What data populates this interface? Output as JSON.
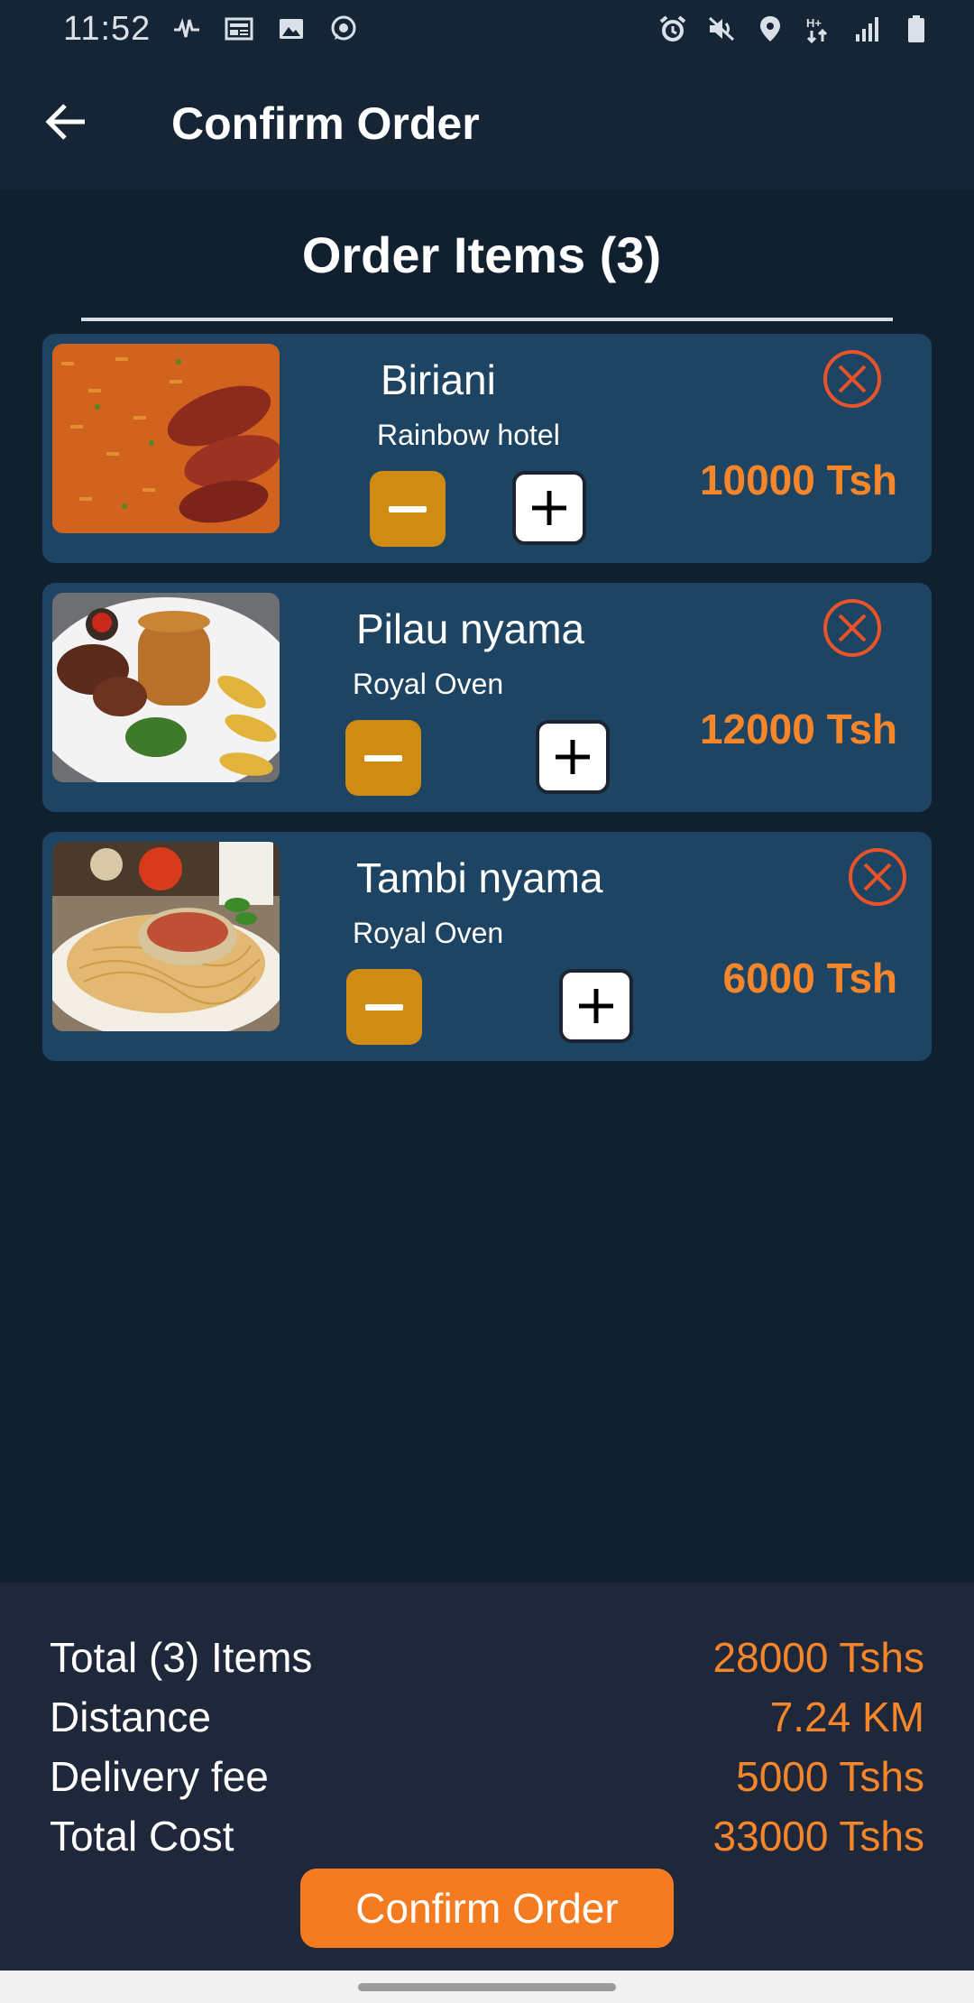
{
  "status_bar": {
    "time": "11:52",
    "left_icons": [
      "pulse-icon",
      "news-icon",
      "image-icon",
      "whatsapp-icon"
    ],
    "right_icons": [
      "alarm-icon",
      "mute-icon",
      "location-icon",
      "data-arrows-icon",
      "signal-icon",
      "battery-icon"
    ]
  },
  "app_bar": {
    "title": "Confirm Order",
    "back_icon": "arrow-left-icon"
  },
  "order_section": {
    "title": "Order Items (3)"
  },
  "items": [
    {
      "name": "Biriani",
      "restaurant": "Rainbow hotel",
      "price": "10000 Tsh"
    },
    {
      "name": "Pilau nyama",
      "restaurant": "Royal Oven",
      "price": "12000 Tsh"
    },
    {
      "name": "Tambi nyama",
      "restaurant": "Royal Oven",
      "price": "6000 Tsh"
    }
  ],
  "summary": {
    "total_items_label": "Total (3) Items",
    "total_items_value": "28000 Tshs",
    "distance_label": "Distance",
    "distance_value": "7.24 KM",
    "delivery_label": "Delivery fee",
    "delivery_value": "5000 Tshs",
    "total_cost_label": "Total Cost",
    "total_cost_value": "33000 Tshs"
  },
  "confirm_button": "Confirm Order",
  "colors": {
    "background": "#10202f",
    "card": "#1e4463",
    "accent_orange": "#f7862a",
    "minus_button": "#d08b12",
    "confirm_button": "#f47b20",
    "remove_icon": "#e8532a"
  }
}
